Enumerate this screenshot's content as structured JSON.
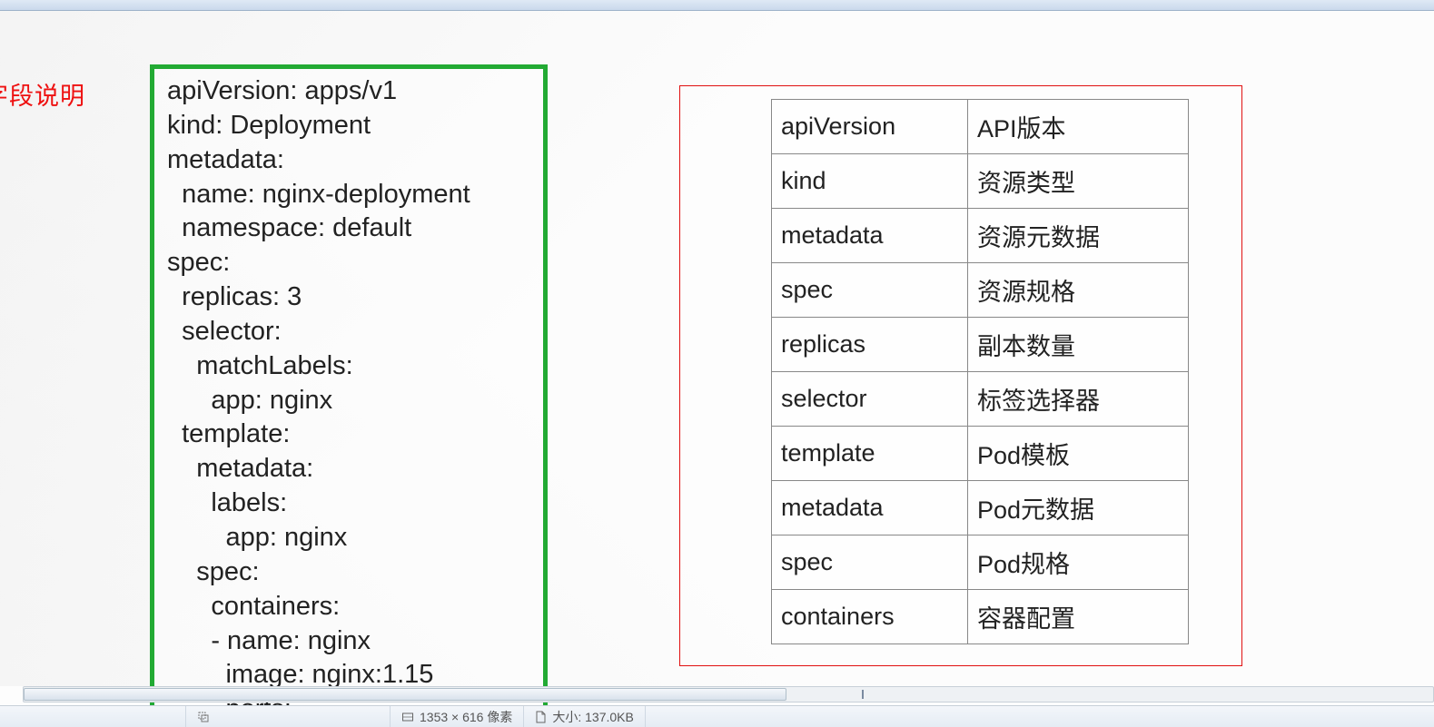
{
  "side_label": "字段说明",
  "yaml_lines": [
    "apiVersion: apps/v1",
    "kind: Deployment",
    "metadata:",
    "  name: nginx-deployment",
    "  namespace: default",
    "spec:",
    "  replicas: 3",
    "  selector:",
    "    matchLabels:",
    "      app: nginx",
    "  template:",
    "    metadata:",
    "      labels:",
    "        app: nginx",
    "    spec:",
    "      containers:",
    "      - name: nginx",
    "        image: nginx:1.15",
    "        ports:"
  ],
  "table": [
    {
      "k": "apiVersion",
      "v": "API版本"
    },
    {
      "k": "kind",
      "v": "资源类型"
    },
    {
      "k": "metadata",
      "v": "资源元数据"
    },
    {
      "k": "spec",
      "v": "资源规格"
    },
    {
      "k": "replicas",
      "v": "副本数量"
    },
    {
      "k": "selector",
      "v": "标签选择器"
    },
    {
      "k": "template",
      "v": "Pod模板"
    },
    {
      "k": "metadata",
      "v": "Pod元数据"
    },
    {
      "k": "spec",
      "v": "Pod规格"
    },
    {
      "k": "containers",
      "v": "容器配置"
    }
  ],
  "status": {
    "dims": "1353 × 616 像素",
    "size": "大小: 137.0KB"
  }
}
